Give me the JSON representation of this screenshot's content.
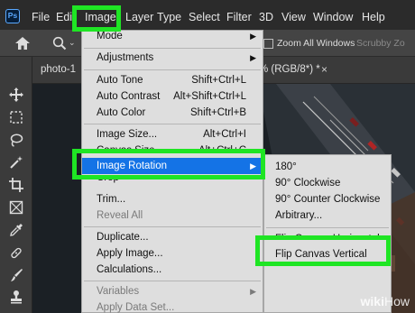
{
  "app": {
    "logo_text": "Ps"
  },
  "menubar": {
    "items": [
      "File",
      "Edit",
      "Image",
      "Layer",
      "Type",
      "Select",
      "Filter",
      "3D",
      "View",
      "Window",
      "Help"
    ]
  },
  "options_bar": {
    "zoom_all_windows": "Zoom All Windows",
    "scrubby_zoom": "Scrubby Zo"
  },
  "document_tab": {
    "title_start": "photo-1",
    "title_end": "% (RGB/8*) *",
    "close_glyph": "×"
  },
  "image_menu": {
    "mode": "Mode",
    "adjustments": "Adjustments",
    "auto_tone": {
      "label": "Auto Tone",
      "shortcut": "Shift+Ctrl+L"
    },
    "auto_contrast": {
      "label": "Auto Contrast",
      "shortcut": "Alt+Shift+Ctrl+L"
    },
    "auto_color": {
      "label": "Auto Color",
      "shortcut": "Shift+Ctrl+B"
    },
    "image_size": {
      "label": "Image Size...",
      "shortcut": "Alt+Ctrl+I"
    },
    "canvas_size": {
      "label": "Canvas Size...",
      "shortcut": "Alt+Ctrl+C"
    },
    "image_rotation": "Image Rotation",
    "crop": "Crop",
    "trim": "Trim...",
    "reveal_all": "Reveal All",
    "duplicate": "Duplicate...",
    "apply_image": "Apply Image...",
    "calculations": "Calculations...",
    "variables": "Variables",
    "apply_data_set": "Apply Data Set..."
  },
  "rotation_submenu": {
    "items": [
      "180°",
      "90° Clockwise",
      "90° Counter Clockwise",
      "Arbitrary..."
    ],
    "flip_horizontal": "Flip Canvas Horizontal",
    "flip_vertical": "Flip Canvas Vertical"
  },
  "watermark": {
    "wiki": "wiki",
    "how": "How"
  },
  "colors": {
    "highlight_green": "#1fe524",
    "selection_blue": "#1473e6",
    "menubar_bg": "#2b2b2b",
    "menu_bg": "#dedede"
  }
}
